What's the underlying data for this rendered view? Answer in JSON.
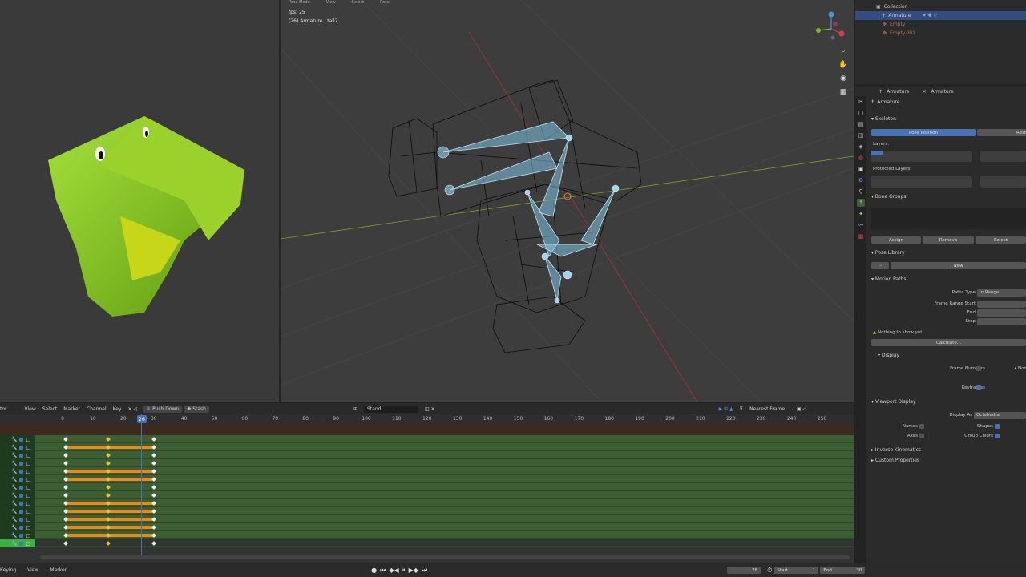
{
  "viewport": {
    "fps_text": "fps: 25",
    "active_text": "(26) Armature : tail2",
    "top_menu": [
      "Pose Mode",
      "View",
      "Select",
      "Pose"
    ]
  },
  "outliner": {
    "rows": [
      {
        "label": "Collection"
      },
      {
        "label": "Armature"
      },
      {
        "label": "Empty"
      },
      {
        "label": "Empty.001"
      }
    ]
  },
  "properties": {
    "breadcrumb": [
      "Armature",
      "Armature"
    ],
    "datablock": "Armature",
    "skeleton_label": "Skeleton",
    "pose_position": "Pose Position",
    "rest_position": "Rest",
    "layers_label": "Layers:",
    "protected_layers_label": "Protected Layers:",
    "bone_groups_label": "Bone Groups",
    "assign": "Assign",
    "remove": "Remove",
    "select": "Select",
    "pose_library_label": "Pose Library",
    "new_label": "New",
    "motion_paths_label": "Motion Paths",
    "paths_type_label": "Paths Type",
    "paths_type_value": "In Range",
    "frame_range_start_label": "Frame Range Start",
    "end_label": "End",
    "step_label": "Step",
    "nothing_to_show": "Nothing to show yet...",
    "calculate": "Calculate...",
    "display_label": "Display",
    "frame_numbers_label": "Frame Numbers",
    "frame_numbers_right": "Nor",
    "keyframes_label": "Keyframes",
    "viewport_display_label": "Viewport Display",
    "display_as_label": "Display As",
    "display_as_value": "Octahedral",
    "names_label": "Names",
    "shapes_label": "Shapes",
    "axes_label": "Axes",
    "group_colors_label": "Group Colors",
    "inverse_kinematics_label": "Inverse Kinematics",
    "custom_properties_label": "Custom Properties"
  },
  "dopesheet": {
    "editor_label": "tor",
    "menus": [
      "View",
      "Select",
      "Marker",
      "Channel",
      "Key"
    ],
    "push_down": "Push Down",
    "stash": "Stash",
    "action_name": "Stand",
    "snap_mode": "Nearest Frame",
    "ruler_ticks": [
      "0",
      "10",
      "20",
      "30",
      "40",
      "50",
      "60",
      "70",
      "80",
      "90",
      "100",
      "110",
      "120",
      "130",
      "140",
      "150",
      "160",
      "170",
      "180",
      "190",
      "200",
      "210",
      "220",
      "230",
      "240",
      "250"
    ],
    "current_frame_badge": "26",
    "channel_rows": 14,
    "key_frames_drawn": [
      1,
      15,
      30
    ],
    "bar_rows": [
      1,
      4,
      5,
      8,
      9,
      10,
      11,
      12
    ]
  },
  "timeline": {
    "menus": [
      "Keying",
      "View",
      "Marker"
    ],
    "current_frame": "28",
    "start_label": "Start",
    "start_value": "1",
    "end_label": "End",
    "end_value": "30"
  },
  "colors": {
    "accent_blue": "#4772b3",
    "keyframe_orange": "#e58a1e",
    "bone_blue": "#7fc4e6",
    "croc_green": "#8ccc1e"
  }
}
